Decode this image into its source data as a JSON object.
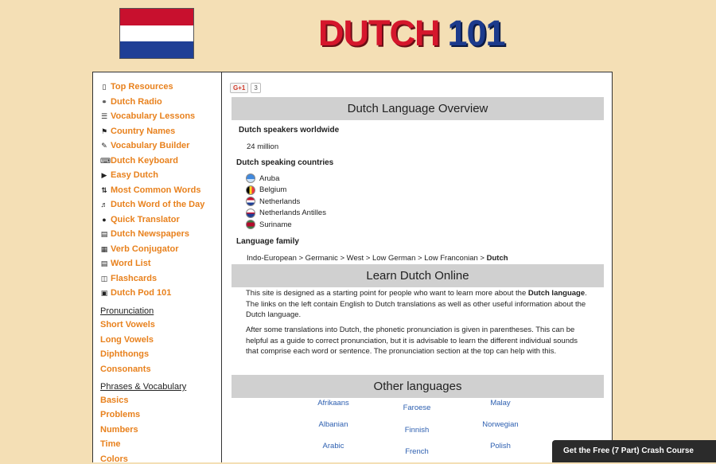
{
  "header": {
    "logo_part1": "DUTCH",
    "logo_part2": "101",
    "flag_colors": [
      "#c8102e",
      "#ffffff",
      "#1f3f96"
    ]
  },
  "sidebar": {
    "items": [
      {
        "icon": "bookmark-icon",
        "label": "Top Resources"
      },
      {
        "icon": "headphones-icon",
        "label": "Dutch Radio"
      },
      {
        "icon": "list-icon",
        "label": "Vocabulary Lessons"
      },
      {
        "icon": "flag-icon",
        "label": "Country Names"
      },
      {
        "icon": "edit-icon",
        "label": "Vocabulary Builder"
      },
      {
        "icon": "keyboard-icon",
        "label": "Dutch Keyboard"
      },
      {
        "icon": "video-icon",
        "label": "Easy Dutch"
      },
      {
        "icon": "sort-icon",
        "label": "Most Common Words"
      },
      {
        "icon": "volume-icon",
        "label": "Dutch Word of the Day"
      },
      {
        "icon": "chat-icon",
        "label": "Quick Translator"
      },
      {
        "icon": "newspaper-icon",
        "label": "Dutch Newspapers"
      },
      {
        "icon": "table-icon",
        "label": "Verb Conjugator"
      },
      {
        "icon": "list-alt-icon",
        "label": "Word List"
      },
      {
        "icon": "book-icon",
        "label": "Flashcards"
      },
      {
        "icon": "podcast-icon",
        "label": "Dutch Pod 101"
      }
    ],
    "pronunciation_heading": "Pronunciation",
    "pronunciation": [
      "Short Vowels",
      "Long Vowels",
      "Diphthongs",
      "Consonants"
    ],
    "phrases_heading": "Phrases & Vocabulary",
    "phrases": [
      "Basics",
      "Problems",
      "Numbers",
      "Time",
      "Colors"
    ]
  },
  "social": {
    "gplus_label": "G+1",
    "count": "3"
  },
  "overview": {
    "title": "Dutch Language Overview",
    "speakers_label": "Dutch speakers worldwide",
    "speakers_value": "24 million",
    "countries_label": "Dutch speaking countries",
    "countries": [
      {
        "name": "Aruba",
        "colors": [
          "#4189dd",
          "#cfe3f7"
        ]
      },
      {
        "name": "Belgium",
        "colors": [
          "#000000",
          "#fdda24",
          "#ef3340"
        ]
      },
      {
        "name": "Netherlands",
        "colors": [
          "#c8102e",
          "#ffffff",
          "#1f3f96"
        ]
      },
      {
        "name": "Netherlands Antilles",
        "colors": [
          "#ffffff",
          "#c8102e",
          "#1f3f96"
        ]
      },
      {
        "name": "Suriname",
        "colors": [
          "#377e3f",
          "#b40a2d",
          "#ecc81d"
        ]
      }
    ],
    "family_label": "Language family",
    "family_path": "Indo-European > Germanic > West > Low German > Low Franconian > ",
    "family_last": "Dutch"
  },
  "learn": {
    "title": "Learn Dutch Online",
    "p1_a": "This site is designed as a starting point for people who want to learn more about the ",
    "p1_b": "Dutch language",
    "p1_c": ". The links on the left contain English to Dutch translations as well as other useful information about the Dutch language.",
    "p2": "After some translations into Dutch, the phonetic pronunciation is given in parentheses. This can be helpful as a guide to correct pronunciation, but it is advisable to learn the different individual sounds that comprise each word or sentence. The pronunciation section at the top can help with this."
  },
  "other": {
    "title": "Other languages",
    "col1": [
      "Afrikaans",
      "Albanian",
      "Arabic"
    ],
    "col2": [
      "Faroese",
      "Finnish",
      "French"
    ],
    "col3": [
      "Malay",
      "Norwegian",
      "Polish"
    ]
  },
  "crash_course": "Get the Free (7 Part) Crash Course"
}
